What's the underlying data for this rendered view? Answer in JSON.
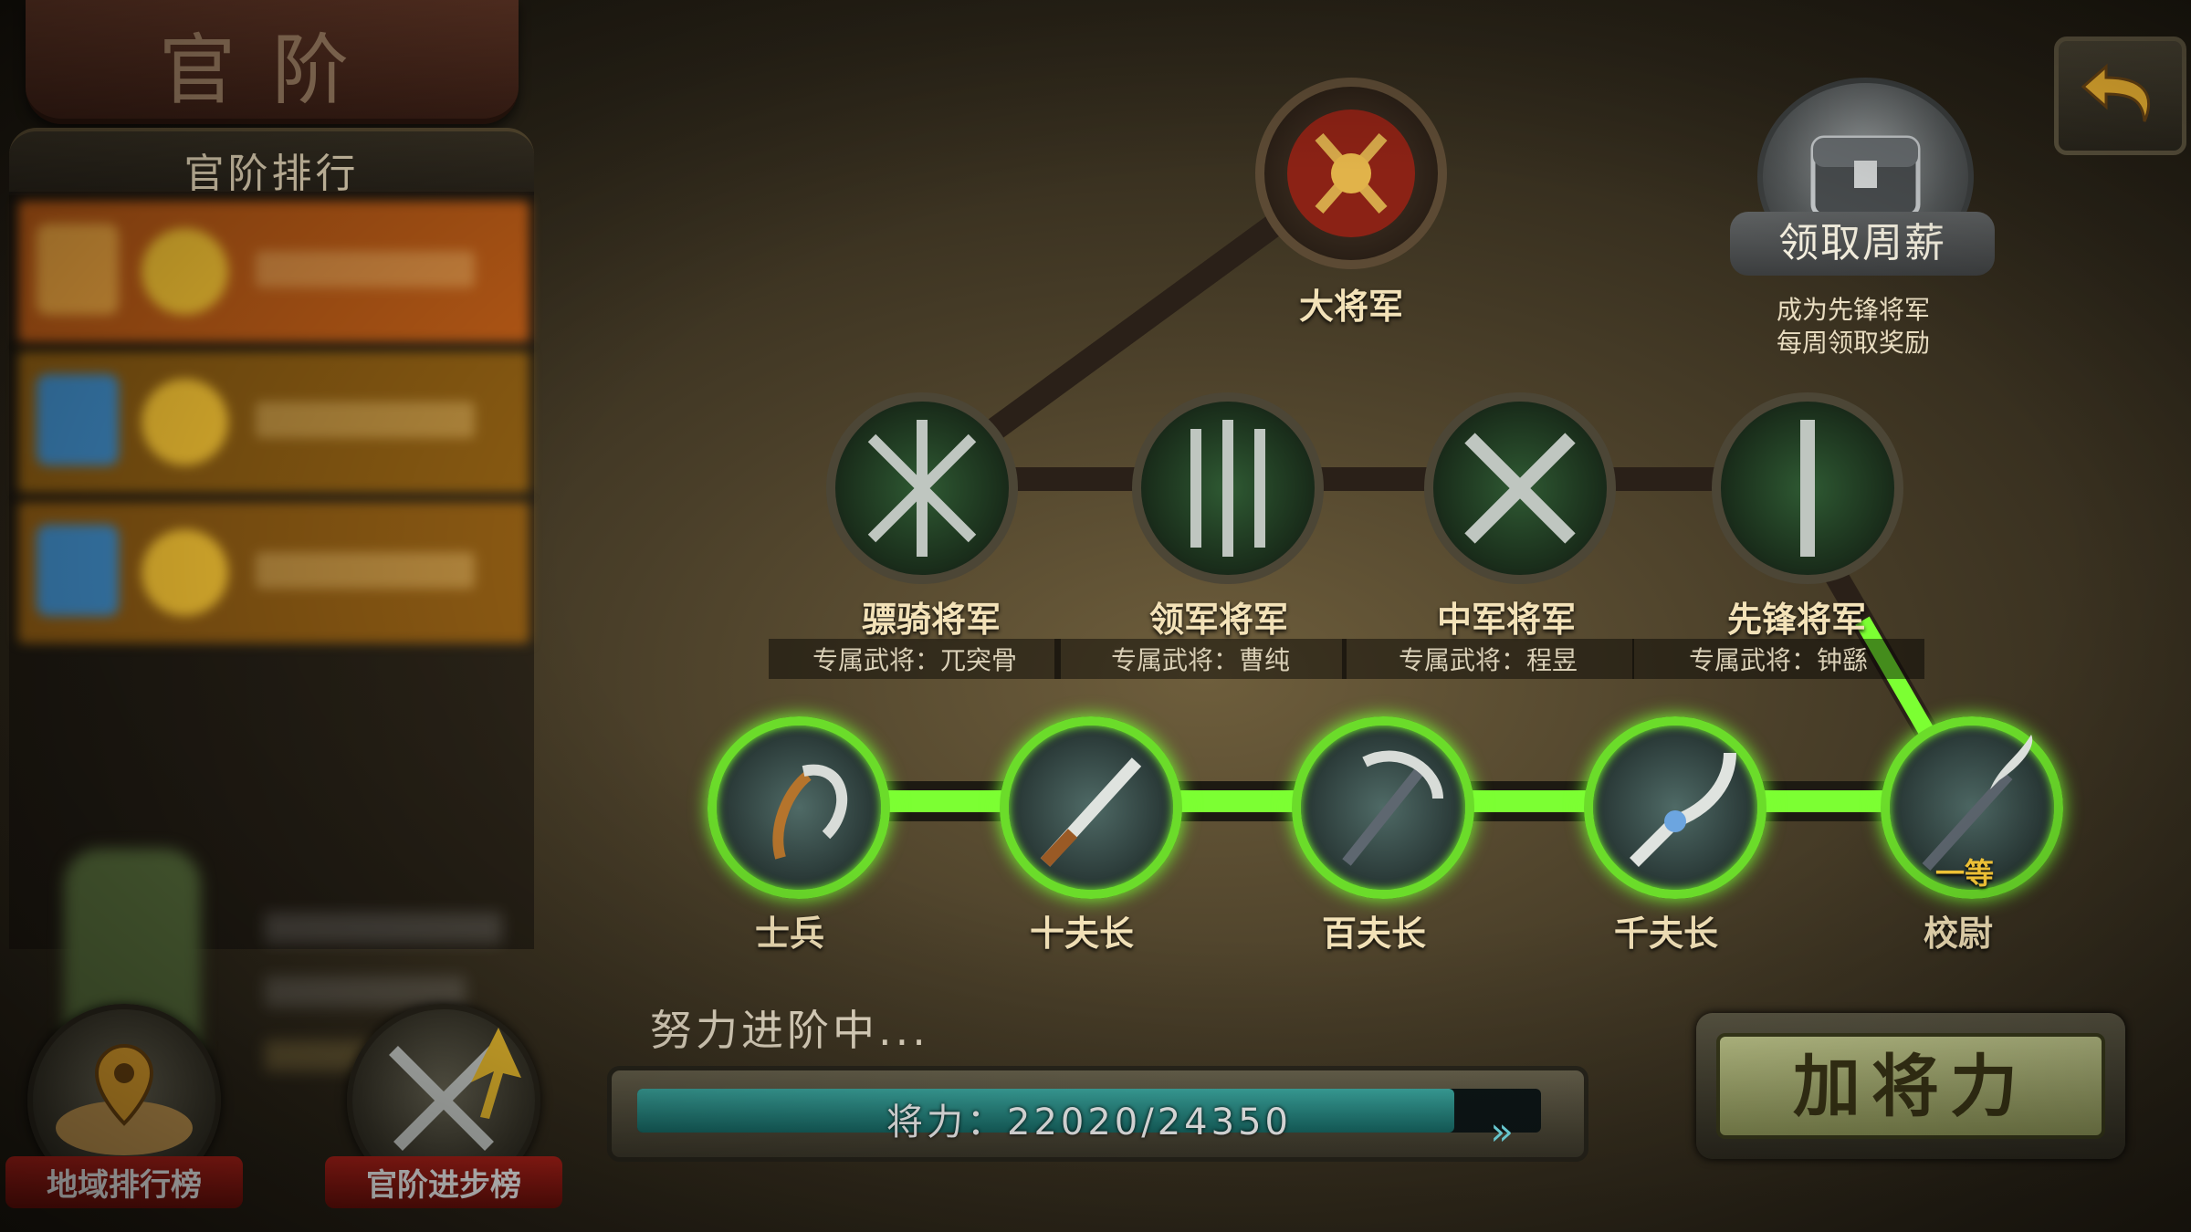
{
  "title": "官阶",
  "ranking": {
    "header": "官阶排行",
    "rows": [
      {
        "bg": "#b85a16"
      },
      {
        "bg": "#8a5b12"
      },
      {
        "bg": "#8c5a13"
      }
    ]
  },
  "bottom_buttons": {
    "region_rank": "地域排行榜",
    "rank_progress": "官阶进步榜"
  },
  "weekly_reward": {
    "button_label": "领取周薪",
    "desc_line1": "成为先锋将军",
    "desc_line2": "每周领取奖励"
  },
  "ranks": {
    "top": {
      "name": "大将军"
    },
    "generals": [
      {
        "name": "骠骑将军",
        "hero": "专属武将：兀突骨"
      },
      {
        "name": "领军将军",
        "hero": "专属武将：曹纯"
      },
      {
        "name": "中军将军",
        "hero": "专属武将：程昱"
      },
      {
        "name": "先锋将军",
        "hero": "专属武将：钟繇"
      }
    ],
    "officers": [
      {
        "name": "士兵"
      },
      {
        "name": "十夫长"
      },
      {
        "name": "百夫长"
      },
      {
        "name": "千夫长"
      },
      {
        "name": "校尉",
        "badge": "一等"
      }
    ]
  },
  "progress": {
    "hint": "努力进阶中...",
    "text": "将力：22020/24350",
    "current": 22020,
    "max": 24350
  },
  "add_power_button": "加将力",
  "colors": {
    "active_path": "#7cff33",
    "progress_fill": "#2a918b",
    "button_face": "#b3ba7a"
  }
}
